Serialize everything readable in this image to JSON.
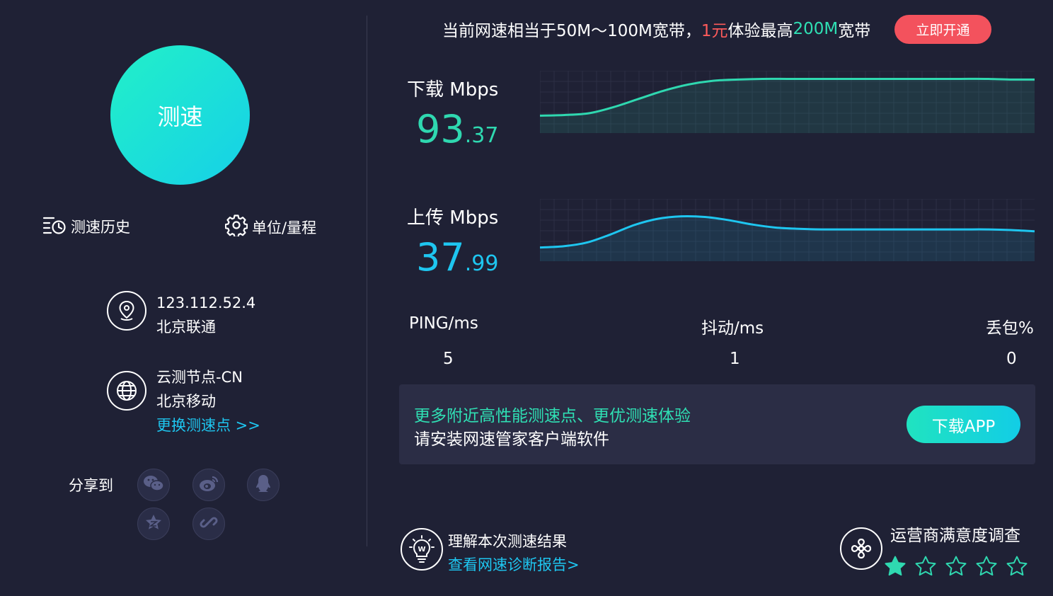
{
  "left": {
    "test_button_label": "测速",
    "history_label": "测速历史",
    "units_label": "单位/量程",
    "ip": "123.112.52.4",
    "isp": "北京联通",
    "node_name": "云测节点-CN",
    "node_isp": "北京移动",
    "change_node_link": "更换测速点 >>",
    "share_label": "分享到"
  },
  "banner": {
    "prefix": "当前网速相当于50M～100M宽带，",
    "price": "1元",
    "middle": "体验最高",
    "highlight": "200M",
    "suffix": "宽带",
    "button": "立即开通"
  },
  "download": {
    "label": "下载 Mbps",
    "value_int": "93",
    "value_dec": ".37",
    "color": "#2fd8b0",
    "curve": [
      0.28,
      0.29,
      0.32,
      0.42,
      0.55,
      0.68,
      0.78,
      0.84,
      0.86,
      0.87,
      0.87,
      0.87,
      0.87,
      0.87,
      0.87,
      0.87,
      0.87,
      0.87,
      0.87,
      0.86,
      0.86
    ]
  },
  "upload": {
    "label": "上传 Mbps",
    "value_int": "37",
    "value_dec": ".99",
    "color": "#1ec6f0",
    "curve": [
      0.22,
      0.24,
      0.3,
      0.43,
      0.58,
      0.68,
      0.72,
      0.71,
      0.66,
      0.59,
      0.54,
      0.52,
      0.51,
      0.51,
      0.51,
      0.51,
      0.51,
      0.51,
      0.51,
      0.51,
      0.5,
      0.48
    ]
  },
  "stats": {
    "ping_label": "PING/ms",
    "ping_value": "5",
    "jitter_label": "抖动/ms",
    "jitter_value": "1",
    "loss_label": "丢包%",
    "loss_value": "0"
  },
  "promo": {
    "line1": "更多附近高性能测速点、更优测速体验",
    "line2": "请安装网速管家客户端软件",
    "button": "下载APP"
  },
  "footer": {
    "understand_title": "理解本次测速结果",
    "report_link": "查看网速诊断报告>",
    "survey_title": "运营商满意度调查",
    "rating": 1,
    "max_rating": 5,
    "star_color": "#2fd8b0"
  }
}
